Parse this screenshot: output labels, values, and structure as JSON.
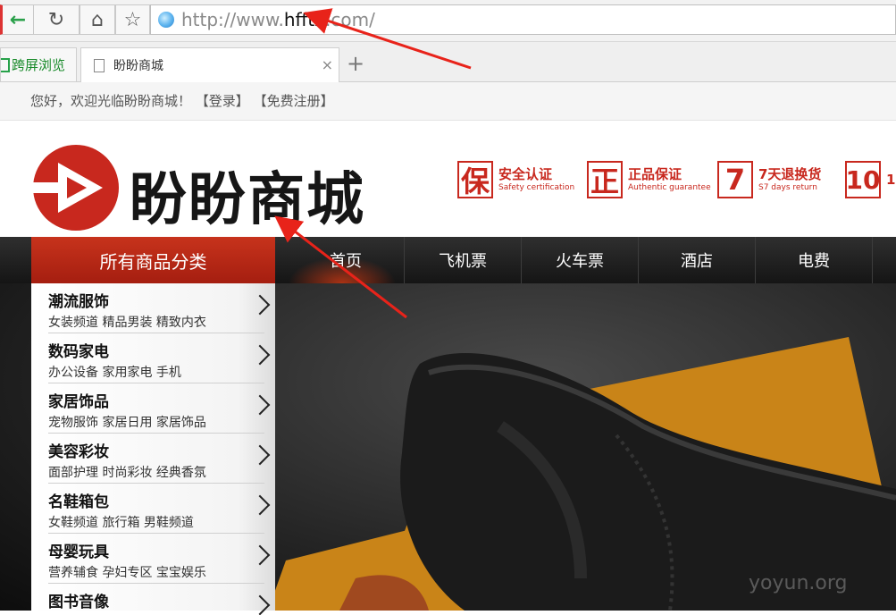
{
  "browser": {
    "address_prefix": "http://www.",
    "address_host": "hfftx",
    "address_suffix": ".com/",
    "tabs": [
      {
        "label": "跨屏浏览"
      },
      {
        "label": "盼盼商城"
      }
    ],
    "new_tab_symbol": "+",
    "close_symbol": "×"
  },
  "site": {
    "welcome": "您好，欢迎光临盼盼商城！",
    "login": "【登录】",
    "register": "【免费注册】",
    "logo_text": "盼盼商城",
    "badges": [
      {
        "icon_char": "保",
        "cn": "安全认证",
        "en": "Safety certification"
      },
      {
        "icon_char": "正",
        "cn": "正品保证",
        "en": "Authentic guarantee"
      },
      {
        "icon_char": "7",
        "cn": "7天退换货",
        "en": "S7 days return"
      },
      {
        "icon_char": "10",
        "cn": "1",
        "en": ""
      }
    ],
    "nav": {
      "category_label": "所有商品分类",
      "items": [
        "首页",
        "飞机票",
        "火车票",
        "酒店",
        "电费"
      ]
    },
    "categories": [
      {
        "title": "潮流服饰",
        "sub": "女装频道 精品男装 精致内衣"
      },
      {
        "title": "数码家电",
        "sub": "办公设备 家用家电 手机"
      },
      {
        "title": "家居饰品",
        "sub": "宠物服饰 家居日用 家居饰品"
      },
      {
        "title": "美容彩妆",
        "sub": "面部护理 时尚彩妆 经典香氛"
      },
      {
        "title": "名鞋箱包",
        "sub": "女鞋频道 旅行箱 男鞋频道"
      },
      {
        "title": "母婴玩具",
        "sub": "营养辅食 孕妇专区 宝宝娱乐"
      },
      {
        "title": "图书音像",
        "sub": ""
      }
    ],
    "watermark": "yoyun.org"
  },
  "colors": {
    "brand_red": "#c8281e",
    "nav_dark": "#1e1e1e",
    "annotation_red": "#e8231a"
  }
}
